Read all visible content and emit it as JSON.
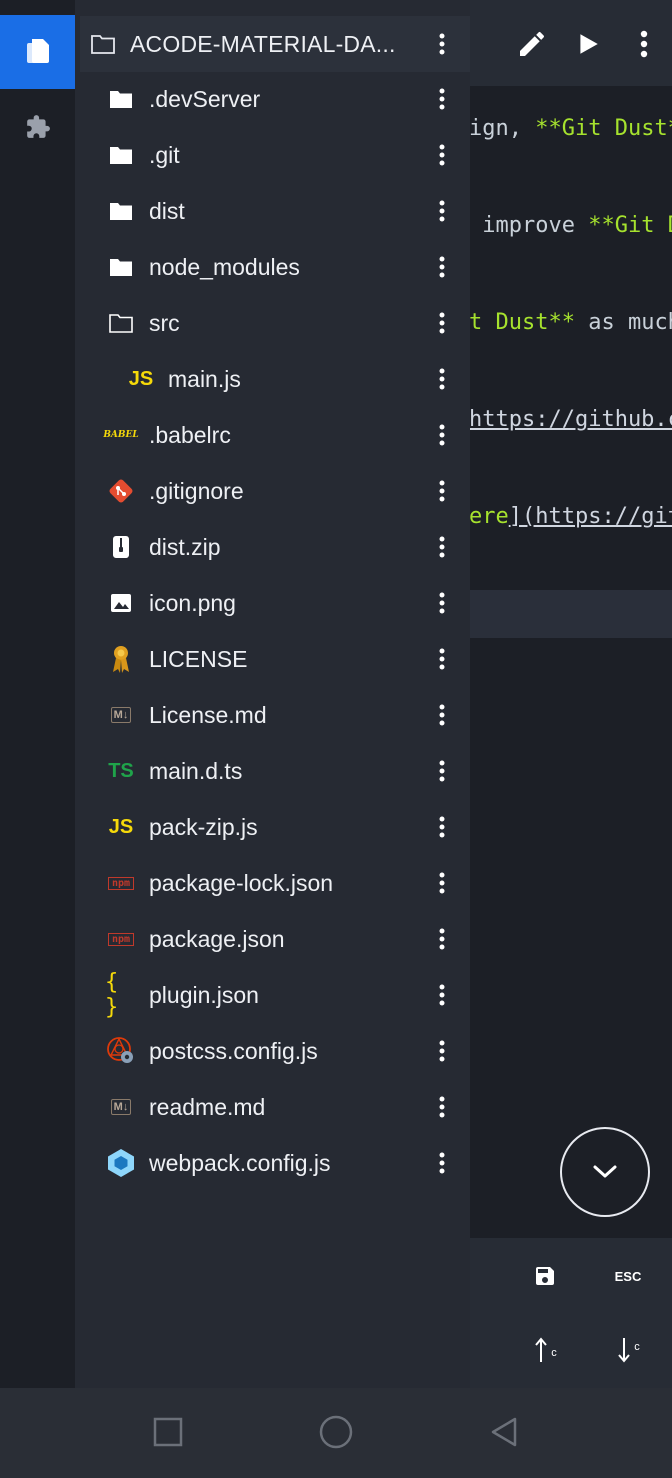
{
  "sidebar": {
    "title": "ACODE-MATERIAL-DA...",
    "files": [
      {
        "name": ".devServer",
        "icon": "folder-icon"
      },
      {
        "name": ".git",
        "icon": "folder-icon"
      },
      {
        "name": "dist",
        "icon": "folder-icon"
      },
      {
        "name": "node_modules",
        "icon": "folder-icon"
      },
      {
        "name": "src",
        "icon": "folder-open-icon"
      },
      {
        "name": "main.js",
        "icon": "javascript-file-icon"
      },
      {
        "name": ".babelrc",
        "icon": "babel-file-icon"
      },
      {
        "name": ".gitignore",
        "icon": "git-file-icon"
      },
      {
        "name": "dist.zip",
        "icon": "zip-file-icon"
      },
      {
        "name": "icon.png",
        "icon": "image-file-icon"
      },
      {
        "name": "LICENSE",
        "icon": "license-file-icon"
      },
      {
        "name": "License.md",
        "icon": "markdown-file-icon"
      },
      {
        "name": "main.d.ts",
        "icon": "typescript-file-icon"
      },
      {
        "name": "pack-zip.js",
        "icon": "javascript-file-icon"
      },
      {
        "name": "package-lock.json",
        "icon": "npm-file-icon"
      },
      {
        "name": "package.json",
        "icon": "npm-file-icon"
      },
      {
        "name": "plugin.json",
        "icon": "json-file-icon"
      },
      {
        "name": "postcss.config.js",
        "icon": "postcss-file-icon"
      },
      {
        "name": "readme.md",
        "icon": "markdown-file-icon"
      },
      {
        "name": "webpack.config.js",
        "icon": "webpack-file-icon"
      }
    ],
    "icon_labels": {
      "js": "JS",
      "ts": "TS",
      "babel": "BABEL",
      "md": "M↓",
      "npm": "npm",
      "brace": "{ }"
    }
  },
  "editor": {
    "lines": [
      {
        "a": "ign, ",
        "b": "**Git Dust*",
        "c": ""
      },
      {
        "a": " improve ",
        "b": "**Git D",
        "c": ""
      },
      {
        "a": "",
        "b": "t Dust**",
        "c": " as much"
      },
      {
        "a": "",
        "b": "",
        "c": "https://github.c"
      },
      {
        "a": "",
        "b": "ere",
        "c": "](https://git"
      }
    ]
  },
  "quicktools": {
    "esc": "ESC",
    "shift_up_label": "c",
    "shift_down_label": "c"
  },
  "colors": {
    "accent": "#1a6ee6",
    "sidebar_bg": "#262a33",
    "editor_bg": "#1c1f26",
    "string_green": "#a6e22e"
  }
}
